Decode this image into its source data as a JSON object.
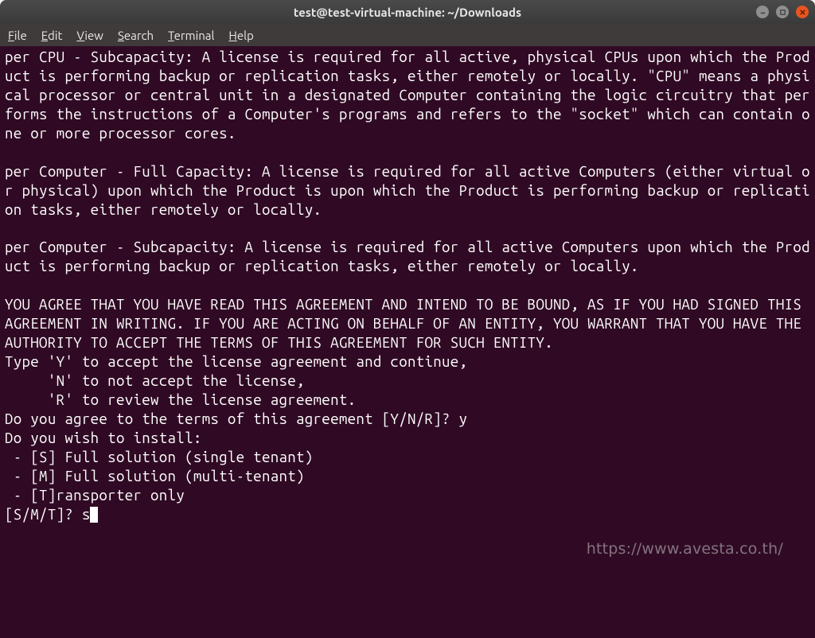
{
  "window": {
    "title": "test@test-virtual-machine: ~/Downloads"
  },
  "menu": {
    "file": "File",
    "edit": "Edit",
    "view": "View",
    "search": "Search",
    "terminal": "Terminal",
    "help": "Help"
  },
  "terminal": {
    "text": "per CPU - Subcapacity: A license is required for all active, physical CPUs upon which the Product is performing backup or replication tasks, either remotely or locally. \"CPU\" means a physical processor or central unit in a designated Computer containing the logic circuitry that performs the instructions of a Computer's programs and refers to the \"socket\" which can contain one or more processor cores.\n\nper Computer - Full Capacity: A license is required for all active Computers (either virtual or physical) upon which the Product is upon which the Product is performing backup or replication tasks, either remotely or locally.\n\nper Computer - Subcapacity: A license is required for all active Computers upon which the Product is performing backup or replication tasks, either remotely or locally.\n\nYOU AGREE THAT YOU HAVE READ THIS AGREEMENT AND INTEND TO BE BOUND, AS IF YOU HAD SIGNED THIS AGREEMENT IN WRITING. IF YOU ARE ACTING ON BEHALF OF AN ENTITY, YOU WARRANT THAT YOU HAVE THE AUTHORITY TO ACCEPT THE TERMS OF THIS AGREEMENT FOR SUCH ENTITY.\nType 'Y' to accept the license agreement and continue,\n     'N' to not accept the license,\n     'R' to review the license agreement.\nDo you agree to the terms of this agreement [Y/N/R]? y\nDo you wish to install:\n - [S] Full solution (single tenant)\n - [M] Full solution (multi-tenant)\n - [T]ransporter only\n[S/M/T]? s",
    "cursor_char": "█"
  },
  "watermark": "https://www.avesta.co.th/"
}
